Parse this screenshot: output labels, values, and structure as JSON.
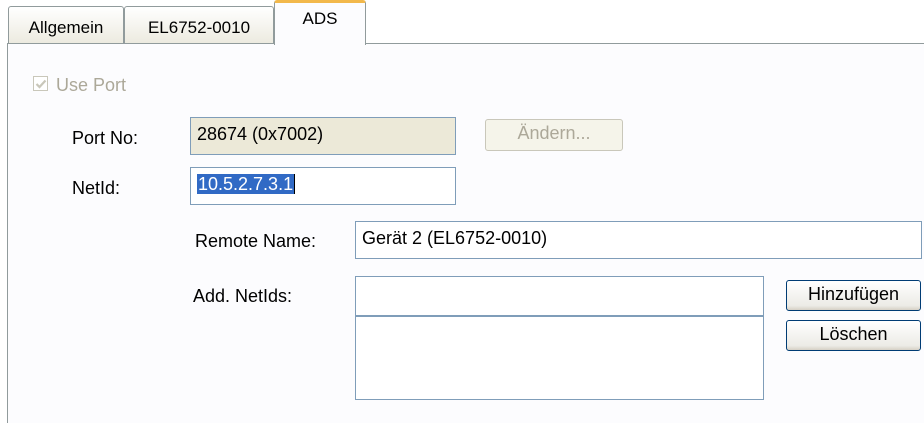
{
  "tabs": [
    {
      "label": "Allgemein"
    },
    {
      "label": "EL6752-0010"
    },
    {
      "label": "ADS"
    }
  ],
  "use_port": {
    "label": "Use Port",
    "checked": true
  },
  "port_no": {
    "label": "Port No:",
    "value": "28674 (0x7002)"
  },
  "change_button": {
    "label": "Ändern..."
  },
  "netid": {
    "label": "NetId:",
    "value": "10.5.2.7.3.1"
  },
  "remote_name": {
    "label": "Remote Name:",
    "value": "Gerät 2 (EL6752-0010)"
  },
  "add_netids": {
    "label": "Add. NetIds:",
    "value": ""
  },
  "add_button": {
    "label": "Hinzufügen"
  },
  "delete_button": {
    "label": "Löschen"
  }
}
